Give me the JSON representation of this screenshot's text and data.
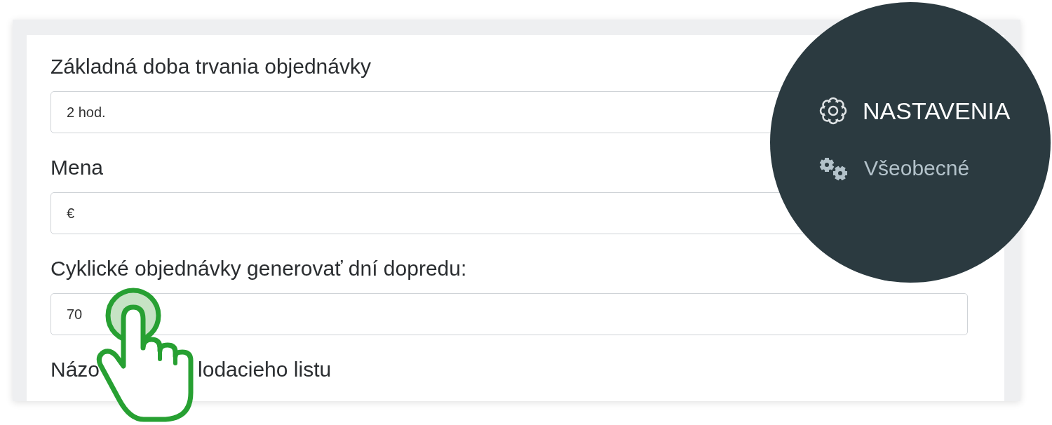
{
  "form": {
    "fields": [
      {
        "label": "Základná doba trvania objednávky",
        "value": "2 hod."
      },
      {
        "label": "Mena",
        "value": "€"
      },
      {
        "label": "Cyklické objednávky generovať dní dopredu:",
        "value": "70"
      }
    ],
    "next_label_parts": [
      "Názo",
      "lodacieho listu"
    ]
  },
  "menu": {
    "title": "NASTAVENIA",
    "items": [
      {
        "label": "Všeobecné"
      }
    ]
  }
}
